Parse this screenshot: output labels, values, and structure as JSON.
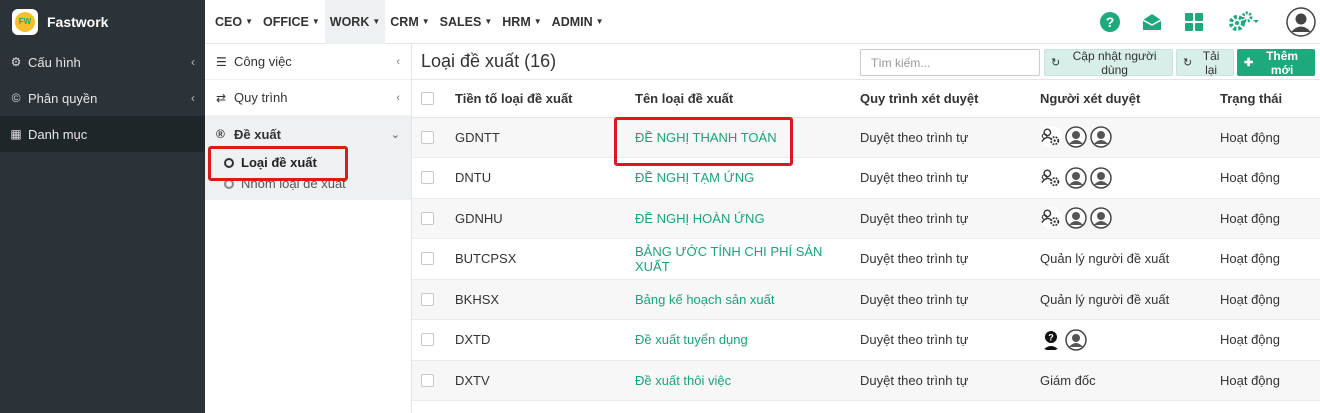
{
  "brand": {
    "name": "Fastwork",
    "logo_text": "FW"
  },
  "sidebar": {
    "items": [
      {
        "label": "Cấu hình",
        "icon": "gear-icon"
      },
      {
        "label": "Phân quyền",
        "icon": "copyright-icon"
      },
      {
        "label": "Danh mục",
        "icon": "calendar-icon"
      }
    ]
  },
  "topnav": {
    "items": [
      "CEO",
      "OFFICE",
      "WORK",
      "CRM",
      "SALES",
      "HRM",
      "ADMIN"
    ],
    "active": "WORK"
  },
  "subnav": {
    "items": [
      {
        "label": "Công việc",
        "icon": "list-icon"
      },
      {
        "label": "Quy trình",
        "icon": "shuffle-icon"
      }
    ],
    "group": {
      "label": "Đề xuất",
      "icon": "registered-icon",
      "children": [
        "Loại đề xuất",
        "Nhóm loại đề xuất"
      ]
    }
  },
  "main": {
    "title": "Loại đề xuất (16)",
    "search_placeholder": "Tìm kiếm...",
    "btn_update_users": "Cập nhật người dùng",
    "btn_reload": "Tải lại",
    "btn_add": "Thêm mới",
    "columns": [
      "Tiền tố loại đề xuất",
      "Tên loại đề xuất",
      "Quy trình xét duyệt",
      "Người xét duyệt",
      "Trạng thái"
    ],
    "rows": [
      {
        "prefix": "GDNTT",
        "name": "ĐỀ NGHỊ THANH TOÁN",
        "flow": "Duyệt theo trình tự",
        "approvers": "",
        "approver_icons": [
          "group-gear",
          "user",
          "user"
        ],
        "status": "Hoạt động"
      },
      {
        "prefix": "DNTU",
        "name": "ĐỀ NGHỊ TẠM ỨNG",
        "flow": "Duyệt theo trình tự",
        "approvers": "",
        "approver_icons": [
          "group-gear",
          "user",
          "user"
        ],
        "status": "Hoạt động"
      },
      {
        "prefix": "GDNHU",
        "name": "ĐỀ NGHỊ HOÀN ỨNG",
        "flow": "Duyệt theo trình tự",
        "approvers": "",
        "approver_icons": [
          "group-gear",
          "user",
          "user"
        ],
        "status": "Hoạt động"
      },
      {
        "prefix": "BUTCPSX",
        "name": "BẢNG ƯỚC TÍNH CHI PHÍ SẢN XUẤT",
        "flow": "Duyệt theo trình tự",
        "approvers": "Quản lý người đề xuất",
        "approver_icons": [],
        "status": "Hoạt động"
      },
      {
        "prefix": "BKHSX",
        "name": "Bảng kế hoạch sản xuất",
        "flow": "Duyệt theo trình tự",
        "approvers": "Quản lý người đề xuất",
        "approver_icons": [],
        "status": "Hoạt động"
      },
      {
        "prefix": "DXTD",
        "name": "Đề xuất tuyển dụng",
        "flow": "Duyệt theo trình tự",
        "approvers": "",
        "approver_icons": [
          "question-user",
          "user"
        ],
        "status": "Hoạt động"
      },
      {
        "prefix": "DXTV",
        "name": "Đề xuất thôi việc",
        "flow": "Duyệt theo trình tự",
        "approvers": "Giám đốc",
        "approver_icons": [],
        "status": "Hoạt động"
      }
    ]
  },
  "colors": {
    "accent": "#1ea97c",
    "sidebar_bg": "#2b3338",
    "highlight": "#e01818"
  }
}
